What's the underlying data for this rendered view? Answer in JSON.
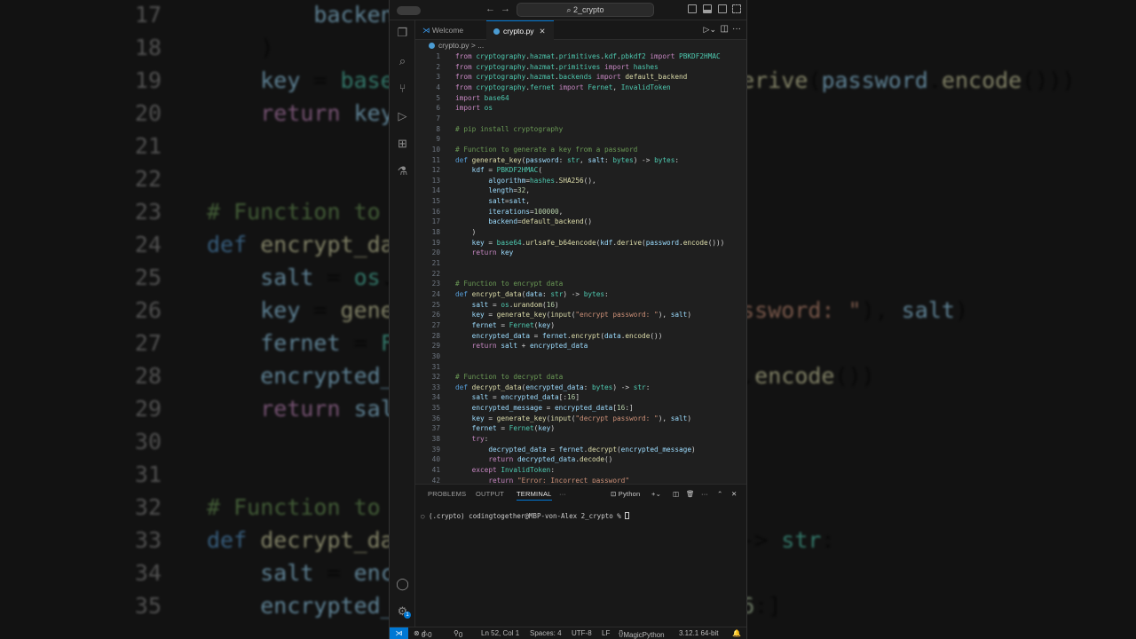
{
  "titlebar": {
    "search": "2_crypto"
  },
  "tabs": [
    {
      "label": "Welcome"
    },
    {
      "label": "crypto.py"
    }
  ],
  "breadcrumb": {
    "file": "crypto.py",
    "sep": "> ..."
  },
  "code": [
    "from cryptography.hazmat.primitives.kdf.pbkdf2 import PBKDF2HMAC",
    "from cryptography.hazmat.primitives import hashes",
    "from cryptography.hazmat.backends import default_backend",
    "from cryptography.fernet import Fernet, InvalidToken",
    "import base64",
    "import os",
    "",
    "# pip install cryptography",
    "",
    "# Function to generate a key from a password",
    "def generate_key(password: str, salt: bytes) -> bytes:",
    "    kdf = PBKDF2HMAC(",
    "        algorithm=hashes.SHA256(),",
    "        length=32,",
    "        salt=salt,",
    "        iterations=100000,",
    "        backend=default_backend()",
    "    )",
    "    key = base64.urlsafe_b64encode(kdf.derive(password.encode()))",
    "    return key",
    "",
    "",
    "# Function to encrypt data",
    "def encrypt_data(data: str) -> bytes:",
    "    salt = os.urandom(16)",
    "    key = generate_key(input(\"encrypt password: \"), salt)",
    "    fernet = Fernet(key)",
    "    encrypted_data = fernet.encrypt(data.encode())",
    "    return salt + encrypted_data",
    "",
    "",
    "# Function to decrypt data",
    "def decrypt_data(encrypted_data: bytes) -> str:",
    "    salt = encrypted_data[:16]",
    "    encrypted_message = encrypted_data[16:]",
    "    key = generate_key(input(\"decrypt password: \"), salt)",
    "    fernet = Fernet(key)",
    "    try:",
    "        decrypted_data = fernet.decrypt(encrypted_message)",
    "        return decrypted_data.decode()",
    "    except InvalidToken:",
    "        return \"Error: Incorrect password\""
  ],
  "panel": {
    "tabs": [
      "PROBLEMS",
      "OUTPUT",
      "TERMINAL"
    ],
    "more": "···",
    "shell": "Python",
    "terminal_line": "(.crypto) codingtogether@MBP-von-Alex 2_crypto % "
  },
  "status": {
    "errors": "0",
    "warnings": "0",
    "ports": "0",
    "position": "Ln 52, Col 1",
    "spaces": "Spaces: 4",
    "encoding": "UTF-8",
    "eol": "LF",
    "language": "MagicPython",
    "interpreter": "3.12.1 64-bit"
  },
  "settings_badge": "1",
  "colors": {
    "accent": "#0078d4"
  }
}
